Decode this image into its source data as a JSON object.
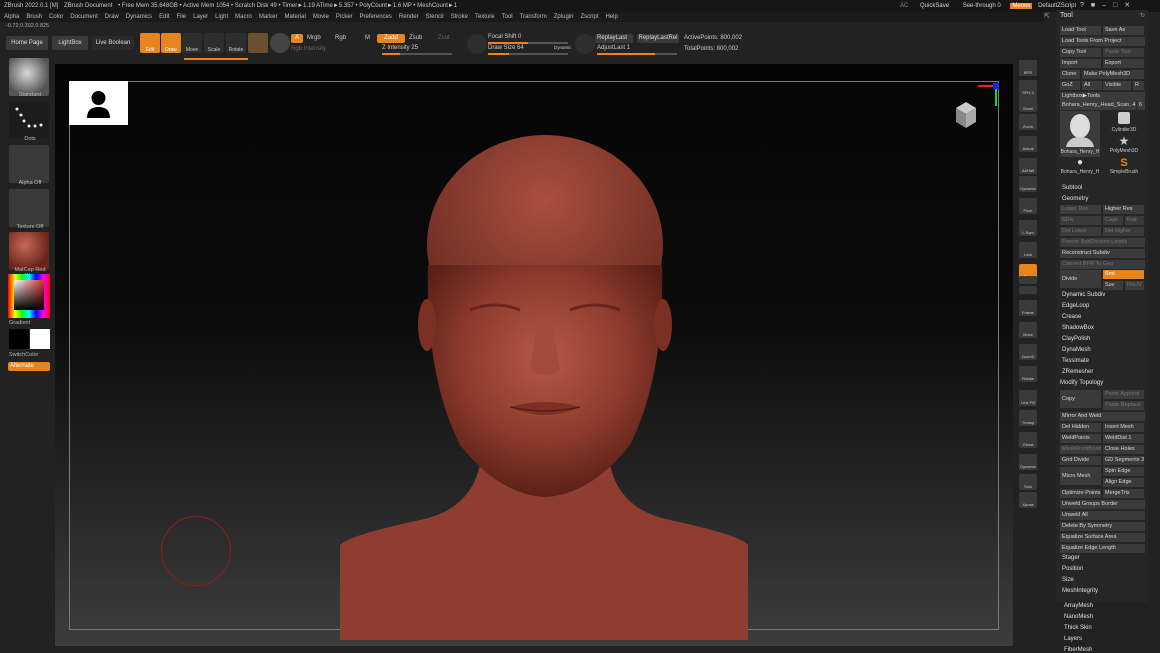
{
  "titlebar": {
    "app": "ZBrush 2022.0.1 [M]",
    "doc": "ZBrush Document",
    "mem": "• Free Mem 35.648GB • Active Mem 1054 • Scratch Disk 49 • Timer►1.19 ATime►5.357 • PolyCount►1.6 MP • MeshCount►1",
    "ac": "AC",
    "quicksave": "QuickSave",
    "see_through": "See-through  0",
    "menus": "Menus",
    "script": "DefaultZScript"
  },
  "menu": [
    "Alpha",
    "Brush",
    "Color",
    "Document",
    "Draw",
    "Dynamics",
    "Edit",
    "File",
    "Layer",
    "Light",
    "Macro",
    "Marker",
    "Material",
    "Movie",
    "Picker",
    "Preferences",
    "Render",
    "Stencil",
    "Stroke",
    "Texture",
    "Tool",
    "Transform",
    "Zplugin",
    "Zscript",
    "Help"
  ],
  "coords": "-0.72,0.302,0.825",
  "top": {
    "home": "Home Page",
    "lightbox": "LightBox",
    "liveboolean": "Live Boolean",
    "edit": "Edit",
    "draw": "Draw",
    "move": "Move",
    "scale": "Scale",
    "rotate": "Rotate",
    "a": "A",
    "mrgb": "Mrgb",
    "rgb": "Rgb",
    "m": "M",
    "rgb_intensity": "Rgb Intensity",
    "zadd": "Zadd",
    "zsub": "Zsub",
    "zcut": "Zcut",
    "z_intensity": "Z Intensity 25",
    "focal": "Focal Shift 0",
    "drawsize": "Draw Size 64",
    "dynamic": "Dynamic",
    "replaylast": "ReplayLast",
    "replaylastrel": "ReplayLastRel",
    "adjustlast": "AdjustLast  1",
    "activepoints": "ActivePoints: 800,002",
    "totalpoints": "TotalPoints: 800,002",
    "z_intensity_val": 25,
    "focal_val": 0,
    "drawsize_val": 64
  },
  "left": {
    "standard": "Standard",
    "dots": "Dots",
    "alphaoff": "Alpha Off",
    "textureoff": "Texture Off",
    "matcap": "MatCap Red Wax",
    "gradient": "Gradient",
    "switchcolor": "SwitchColor",
    "alternate": "Alternate"
  },
  "rstrip": [
    "BPR",
    "SPix 3",
    "Scroll",
    "Zoom",
    "Actual",
    "AAHalf",
    "Dynamic Persp",
    "Floor",
    "L.Sym",
    "Lock",
    "Qxyz",
    "",
    "",
    "Frame",
    "Move",
    "ZoomD",
    "Rotate",
    "Line Fill PolyF",
    "Transp",
    "Ghost",
    "Dynamic",
    "Solo",
    "Xpose"
  ],
  "tool": {
    "title": "Tool",
    "load": "Load Tool",
    "saveas": "Save As",
    "loadproj": "Load Tools From Project",
    "copytool": "Copy Tool",
    "pastetool": "Paste Tool",
    "import": "Import",
    "export": "Export",
    "clone": "Clone",
    "makepoly": "Make PolyMesh3D",
    "goz": "GoZ",
    "all": "All",
    "visible": "Visible",
    "r": "R",
    "lightboxtools": "Lightbox▶Tools",
    "current": "Bohara_Henry_Head_Scan. 4",
    "n6": "6",
    "thumb1": "Bohara_Henry_H",
    "thumb2": "Cylinder3D",
    "thumb3": "PolyMesh3D",
    "thumb4": "Bohara_Henry_H",
    "thumb5": "SimpleBrush",
    "subtool": "Subtool",
    "geometry": "Geometry",
    "lowerres": "Lower Res",
    "higherres": "Higher Res",
    "sdiv": "SDiv",
    "cage": "Cage",
    "rstr": "Rstr",
    "dellower": "Del Lower",
    "delhigher": "Del Higher",
    "freeze": "Freeze SubDivision Levels",
    "reconstruct": "Reconstruct Subdiv",
    "convertbpr": "Convert BPR To Geo",
    "divide": "Divide",
    "smt": "Smt",
    "suv": "Suv",
    "reluv": "ReUV",
    "items1": [
      "Dynamic Subdiv",
      "EdgeLoop",
      "Crease",
      "ShadowBox",
      "ClayPolish",
      "DynaMesh",
      "Tessimate",
      "ZRemesher"
    ],
    "modtopo": "Modify Topology",
    "copy": "Copy",
    "pasteappend": "Paste Append",
    "pastereplace": "Paste Replace",
    "mirrorweld": "Mirror And Weld",
    "delhidden": "Del Hidden",
    "insertmesh": "Insert Mesh",
    "weldpoints": "WeldPoints",
    "welddist": "WeldDist 1",
    "meshfromb": "MeshFromBrush",
    "closeholes": "Close Holes",
    "griddivide": "Grid Divide",
    "gdsegments": "GD Segments 3",
    "micromesh": "Micro Mesh",
    "spinedge": "Spin Edge",
    "alignedge": "Align Edge",
    "optimize": "Optimize Points",
    "mergetris": "MergeTris",
    "unweldborder": "Unweld Groups Border",
    "unweldall": "Unweld All",
    "delsym": "Delete By Symmetry",
    "eqsurf": "Equalize Surface Area",
    "eqedge": "Equalize Edge Length",
    "items2": [
      "Stager",
      "Position",
      "Size",
      "MeshIntegrity"
    ],
    "items3": [
      "ArrayMesh",
      "NanoMesh",
      "Thick Skin",
      "Layers",
      "FiberMesh"
    ]
  },
  "colors": {
    "accent": "#e8841e",
    "clay": "#9a4434"
  }
}
